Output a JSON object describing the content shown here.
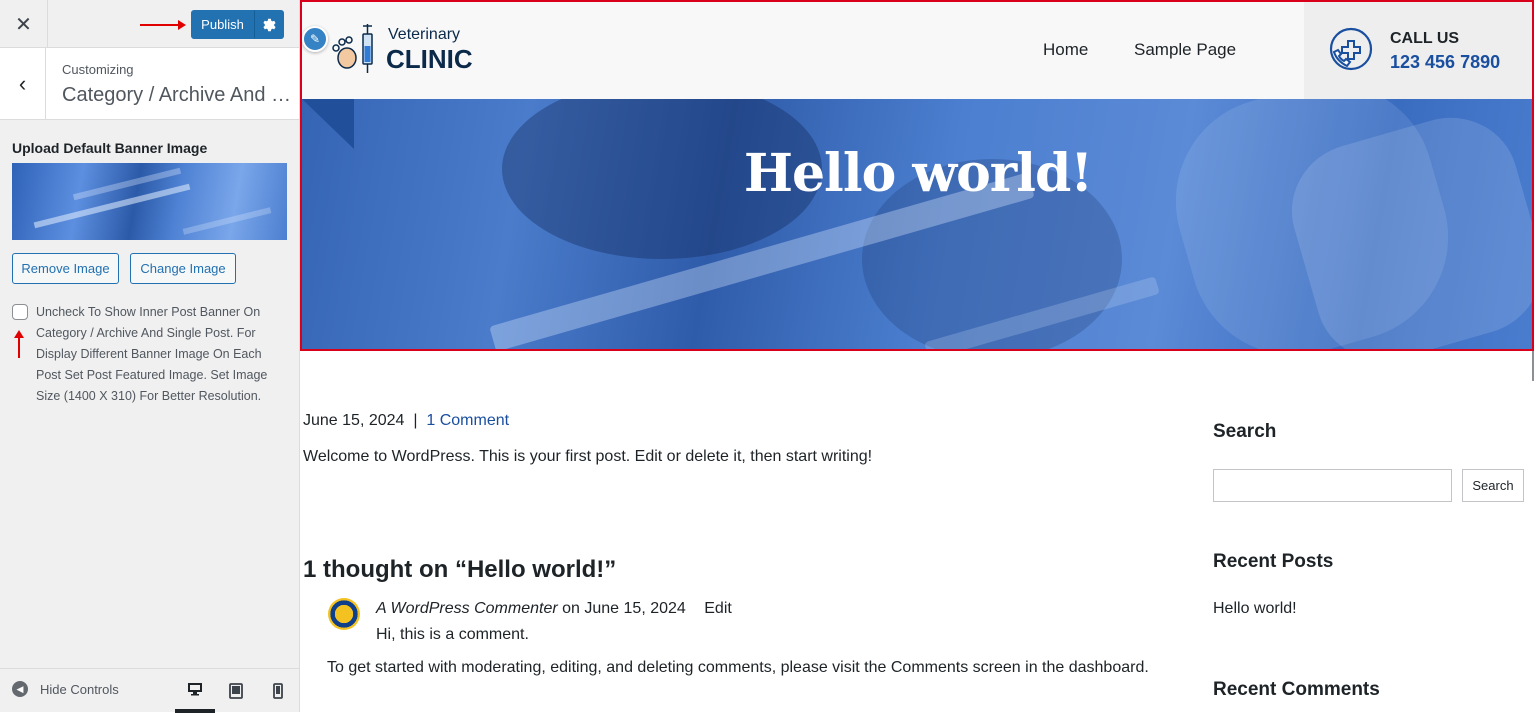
{
  "customizer": {
    "close_icon": "close-icon",
    "publish_label": "Publish",
    "settings_icon": "gear-icon",
    "customizing_label": "Customizing",
    "section_title": "Category / Archive And Single Post",
    "control_label": "Upload Default Banner Image",
    "remove_image_label": "Remove Image",
    "change_image_label": "Change Image",
    "checkbox_checked": false,
    "checkbox_description": "Uncheck To Show Inner Post Banner On Category / Archive And Single Post. For Display Different Banner Image On Each Post Set Post Featured Image. Set Image Size (1400 X 310) For Better Resolution.",
    "hide_controls_label": "Hide Controls",
    "devices": [
      "desktop",
      "tablet",
      "mobile"
    ],
    "active_device": "desktop",
    "accent_color": "#2271b1",
    "annotation_color": "#e00000"
  },
  "site": {
    "logo_small": "Veterinary",
    "logo_big": "CLINIC",
    "nav": [
      "Home",
      "Sample Page"
    ],
    "call_label": "CALL US",
    "call_number": "123 456 7890",
    "hero_title": "Hello world!",
    "brand_color": "#1a4fa0"
  },
  "post": {
    "date": "June 15, 2024",
    "separator": "|",
    "comments_link": "1 Comment",
    "body": "Welcome to WordPress. This is your first post. Edit or delete it, then start writing!"
  },
  "comments": {
    "heading": "1 thought on “Hello world!”",
    "author": "A WordPress Commenter",
    "on_word": "on",
    "date": "June 15, 2024",
    "edit_label": "Edit",
    "line1": "Hi, this is a comment.",
    "line2": "To get started with moderating, editing, and deleting comments, please visit the Comments screen in the dashboard."
  },
  "widgets": {
    "search_title": "Search",
    "search_button": "Search",
    "search_value": "",
    "recent_posts_title": "Recent Posts",
    "recent_posts": [
      "Hello world!"
    ],
    "recent_comments_title": "Recent Comments"
  }
}
